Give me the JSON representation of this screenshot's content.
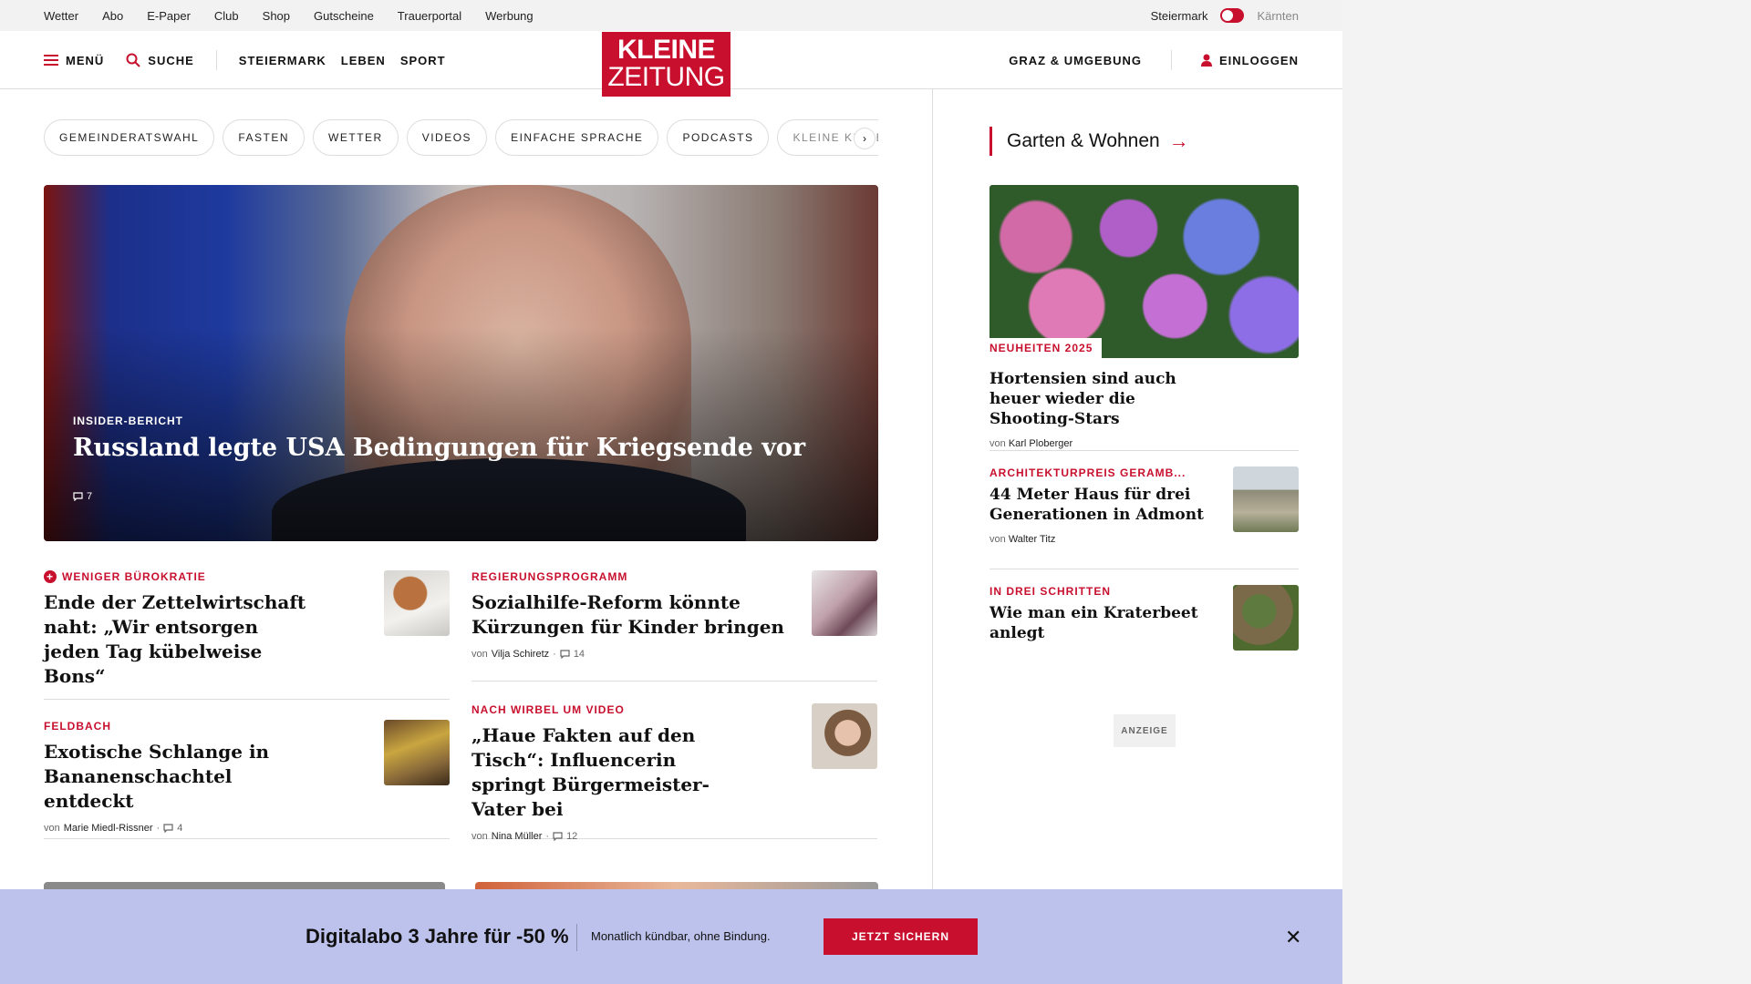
{
  "utility": {
    "links": [
      "Wetter",
      "Abo",
      "E-Paper",
      "Club",
      "Shop",
      "Gutscheine",
      "Trauerportal",
      "Werbung"
    ],
    "region_active": "Steiermark",
    "region_inactive": "Kärnten"
  },
  "header": {
    "menu_label": "MENÜ",
    "search_label": "SUCHE",
    "nav": [
      "STEIERMARK",
      "LEBEN",
      "SPORT"
    ],
    "logo_line1": "KLEINE",
    "logo_line2": "ZEITUNG",
    "region_link": "GRAZ & UMGEBUNG",
    "login_label": "EINLOGGEN"
  },
  "chips": [
    "GEMEINDERATSWAHL",
    "FASTEN",
    "WETTER",
    "VIDEOS",
    "EINFACHE SPRACHE",
    "PODCASTS",
    "KLEINE KINDE"
  ],
  "chips_next": "›",
  "hero": {
    "kicker": "INSIDER-BERICHT",
    "title": "Russland legte USA Bedingungen für Kriegsende vor",
    "comments": "7"
  },
  "articles": [
    {
      "kicker": "WENIGER BÜROKRATIE",
      "premium": true,
      "title": "Ende der Zettelwirtschaft naht: „Wir entsorgen jeden Tag kübelweise Bons“",
      "by_prefix": "",
      "author": "",
      "comments": ""
    },
    {
      "kicker": "REGIERUNGSPROGRAMM",
      "premium": false,
      "title": "Sozialhilfe-Reform könnte Kürzungen für Kinder bringen",
      "by_prefix": "von",
      "author": "Vilja Schiretz",
      "comments": "14"
    },
    {
      "kicker": "FELDBACH",
      "premium": false,
      "title": "Exotische Schlange in Bananenschachtel entdeckt",
      "by_prefix": "von",
      "author": "Marie Miedl-Rissner",
      "comments": "4"
    },
    {
      "kicker": "NACH WIRBEL UM VIDEO",
      "premium": false,
      "title": "„Haue Fakten auf den Tisch“: Influencerin springt Bürgermeister-Vater bei",
      "by_prefix": "von",
      "author": "Nina Müller",
      "comments": "12"
    }
  ],
  "sidebar": {
    "section_title": "Garten & Wohnen",
    "section_arrow": "→",
    "featured": {
      "badge": "NEUHEITEN 2025",
      "title": "Hortensien sind auch heuer wieder die Shooting-Stars",
      "by_prefix": "von",
      "author": "Karl Ploberger"
    },
    "items": [
      {
        "kicker": "ARCHITEKTURPREIS GERAMB...",
        "title": "44 Meter Haus für drei Generationen in Admont",
        "by_prefix": "von",
        "author": "Walter Titz"
      },
      {
        "kicker": "IN DREI SCHRITTEN",
        "title": "Wie man ein Kraterbeet anlegt",
        "by_prefix": "",
        "author": ""
      }
    ],
    "ad_label": "ANZEIGE"
  },
  "banner": {
    "title": "Digitalabo 3 Jahre für -50 %",
    "text": "Monatlich kündbar, ohne Bindung.",
    "button": "JETZT SICHERN",
    "close": "✕"
  },
  "colors": {
    "brand_red": "#c8102e",
    "banner_bg": "#bdc2ec"
  }
}
